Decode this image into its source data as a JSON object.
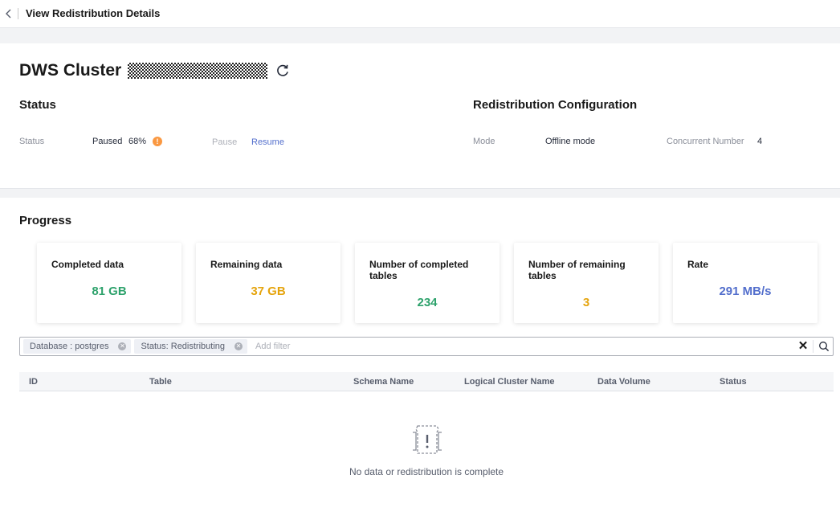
{
  "header": {
    "back_icon": "chevron-left-icon",
    "title": "View Redistribution Details"
  },
  "cluster": {
    "prefix": "DWS Cluster",
    "name_masked": true,
    "refresh_icon": "refresh-icon"
  },
  "status_section": {
    "title": "Status",
    "status_label": "Status",
    "status_value": "Paused",
    "percent": "68%",
    "warning_icon": "warning-icon",
    "actions": {
      "pause": "Pause",
      "resume": "Resume"
    }
  },
  "config_section": {
    "title": "Redistribution Configuration",
    "mode_label": "Mode",
    "mode_value": "Offline mode",
    "concurrent_label": "Concurrent Number",
    "concurrent_value": "4"
  },
  "progress": {
    "title": "Progress",
    "cards": [
      {
        "label": "Completed data",
        "value": "81 GB",
        "color": "#2ea26c"
      },
      {
        "label": "Remaining data",
        "value": "37 GB",
        "color": "#e5a40d"
      },
      {
        "label": "Number of completed tables",
        "value": "234",
        "color": "#2ea26c"
      },
      {
        "label": "Number of remaining tables",
        "value": "3",
        "color": "#e5a40d"
      },
      {
        "label": "Rate",
        "value": "291 MB/s",
        "color": "#526ecc"
      }
    ]
  },
  "filter": {
    "chips": [
      "Database : postgres",
      "Status: Redistributing"
    ],
    "placeholder": "Add filter",
    "clear_icon": "close-icon",
    "search_icon": "search-icon"
  },
  "table": {
    "columns": [
      "ID",
      "Table",
      "Schema Name",
      "Logical Cluster Name",
      "Data Volume",
      "Status"
    ],
    "rows": []
  },
  "empty_state": {
    "icon": "empty-state-icon",
    "text": "No data or redistribution is complete"
  },
  "colors": {
    "link": "#526ecc",
    "warning": "#fa9841"
  }
}
